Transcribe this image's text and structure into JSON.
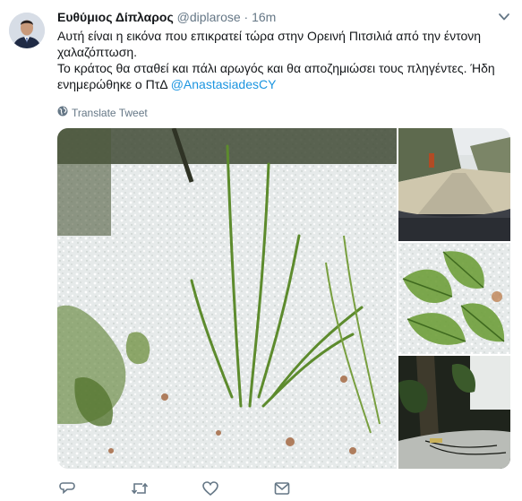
{
  "tweet": {
    "author_name": "Ευθύμιος Δίπλαρος",
    "handle": "@diplarose",
    "separator": "·",
    "time": "16m",
    "text_line1": "Αυτή είναι η εικόνα που επικρατεί τώρα στην Ορεινή Πιτσιλιά από την έντονη χαλαζόπτωση.",
    "text_line2": "Το κράτος θα σταθεί και πάλι αρωγός και θα αποζημιώσει τους πληγέντες. Ήδη ενημερώθηκε ο ΠτΔ",
    "mention": "@AnastasiadesCY",
    "translate_label": "Translate Tweet"
  },
  "colors": {
    "link": "#1b95e0",
    "secondary_text": "#657786",
    "primary_text": "#14171a"
  },
  "icons": [
    "chevron-down-icon",
    "globe-icon",
    "reply-icon",
    "retweet-icon",
    "like-icon",
    "message-icon"
  ]
}
